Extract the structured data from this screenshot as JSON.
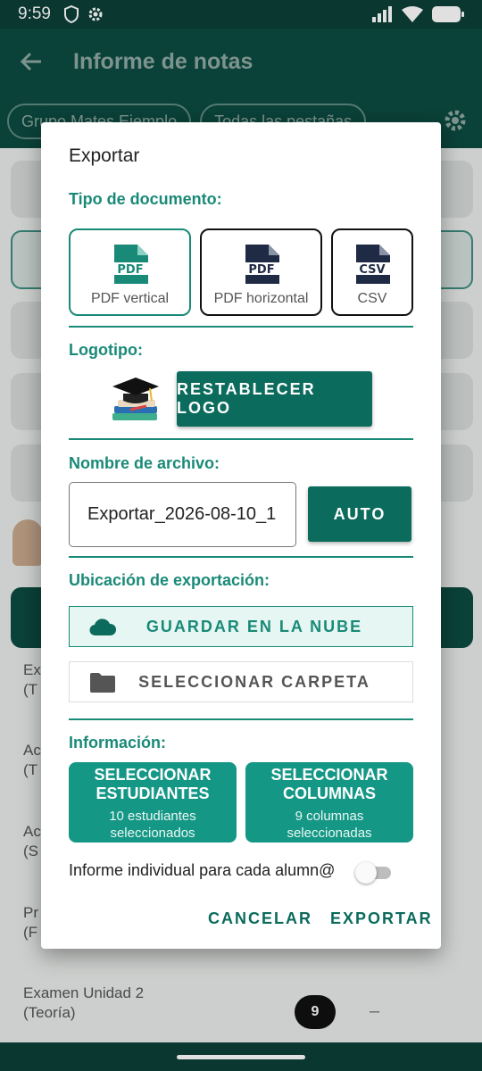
{
  "status_bar": {
    "time": "9:59"
  },
  "app_bar": {
    "title": "Informe de notas"
  },
  "chips": [
    "Grupo Mates Ejemplo",
    "Todas las pestañas"
  ],
  "background_items": [
    {
      "line1": "Ex",
      "line2": "(T"
    },
    {
      "line1": "Ac",
      "line2": "(T"
    },
    {
      "line1": "Ac",
      "line2": "(S"
    },
    {
      "line1": "Pr",
      "line2": "(F"
    },
    {
      "line1": "Examen Unidad 2",
      "line2": "(Teoría)"
    }
  ],
  "background_score": "9",
  "background_dash": "–",
  "dialog": {
    "title": "Exportar",
    "doc_type": {
      "label": "Tipo de documento:",
      "options": [
        {
          "label": "PDF vertical",
          "icon_text": "PDF",
          "selected": true
        },
        {
          "label": "PDF horizontal",
          "icon_text": "PDF",
          "selected": false
        },
        {
          "label": "CSV",
          "icon_text": "CSV",
          "selected": false
        }
      ]
    },
    "logo": {
      "label": "Logotipo:",
      "reset_button": "RESTABLECER LOGO"
    },
    "filename": {
      "label": "Nombre de archivo:",
      "value": "Exportar_2026-08-10_1",
      "auto_button": "AUTO"
    },
    "location": {
      "label": "Ubicación de exportación:",
      "cloud_button": "GUARDAR EN LA NUBE",
      "folder_button": "SELECCIONAR CARPETA"
    },
    "info": {
      "label": "Información:",
      "students_button": {
        "title_line1": "SELECCIONAR",
        "title_line2": "ESTUDIANTES",
        "sub_line1": "10 estudiantes",
        "sub_line2": "seleccionados"
      },
      "columns_button": {
        "title_line1": "SELECCIONAR",
        "title_line2": "COLUMNAS",
        "sub_line1": "9 columnas",
        "sub_line2": "seleccionadas"
      }
    },
    "individual_report": {
      "label": "Informe individual para cada alumn@",
      "enabled": false
    },
    "actions": {
      "cancel": "CANCELAR",
      "export": "EXPORTAR"
    }
  },
  "colors": {
    "accent": "#1a8a78",
    "primary_dark": "#0b6b5c",
    "info_button": "#159786",
    "app_bar": "#0c4a40"
  }
}
